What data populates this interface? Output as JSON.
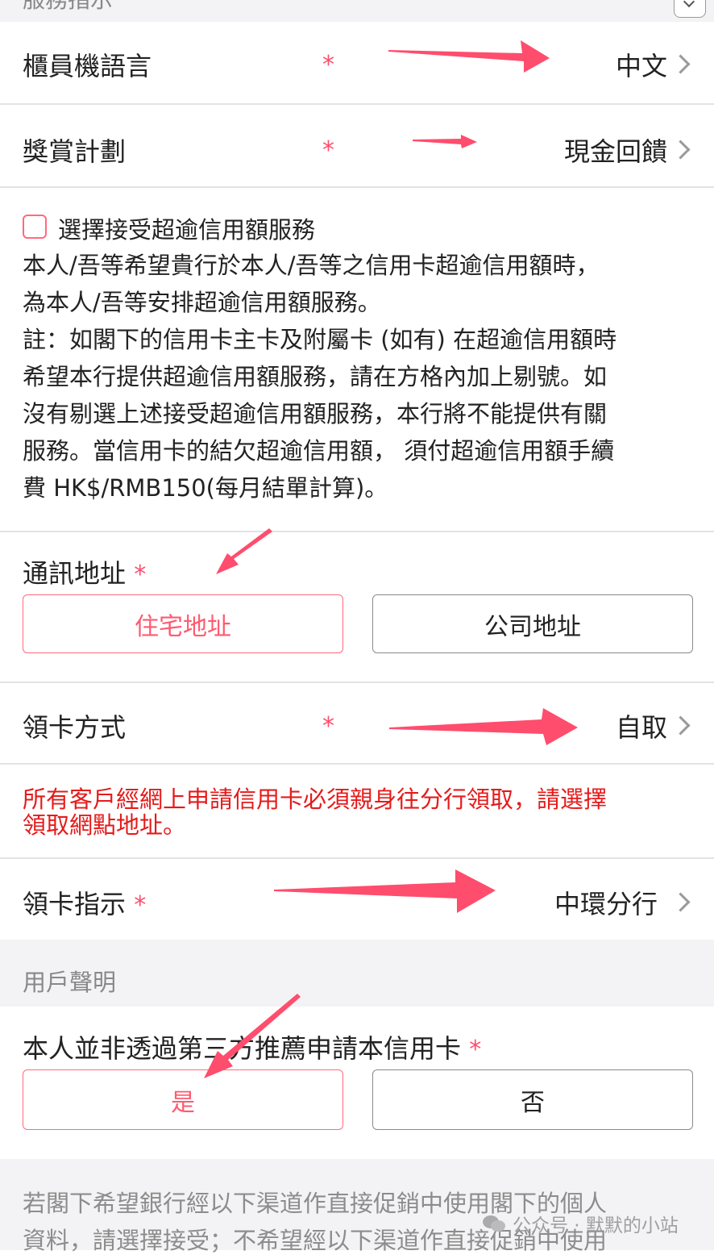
{
  "top_section": {
    "partial_title": "服務指示"
  },
  "kiosk_language": {
    "label": "櫃員機語言",
    "required": "*",
    "value": "中文"
  },
  "reward_plan": {
    "label": "獎賞計劃",
    "required": "*",
    "value": "現金回饋"
  },
  "over_limit": {
    "checkbox_label": "選擇接受超逾信用額服務",
    "lines": [
      "本人/吾等希望貴行於本人/吾等之信用卡超逾信用額時，",
      "為本人/吾等安排超逾信用額服務。",
      "註：如閣下的信用卡主卡及附屬卡 (如有) 在超逾信用額時",
      "希望本行提供超逾信用額服務，請在方格內加上剔號。如",
      "沒有剔選上述接受超逾信用額服務，本行將不能提供有關",
      "服務。當信用卡的結欠超逾信用額，  須付超逾信用額手續",
      "費 HK$/RMB150(每月結單計算)。"
    ]
  },
  "address": {
    "label": "通訊地址",
    "required": "*",
    "options": [
      "住宅地址",
      "公司地址"
    ],
    "selected": "住宅地址"
  },
  "card_collection": {
    "label": "領卡方式",
    "required": "*",
    "value": "自取"
  },
  "notice": {
    "lines": [
      "所有客戶經網上申請信用卡必須親身往分行領取，請選擇",
      "領取網點地址。"
    ],
    "color": "#e51b1b"
  },
  "card_instruction": {
    "label": "領卡指示",
    "required": "*",
    "value": "中環分行"
  },
  "user_declaration": {
    "section_title": "用戶聲明"
  },
  "referral": {
    "question": "本人並非透過第三方推薦申請本信用卡",
    "required": "*",
    "options": [
      "是",
      "否"
    ],
    "selected": "是"
  },
  "marketing": {
    "lines": [
      "若閣下希望銀行經以下渠道作直接促銷中使用閣下的個人",
      "資料，請選擇接受；不希望經以下渠道作直接促銷中使用"
    ]
  },
  "watermark": {
    "text": "公众号 · 默默的小站"
  },
  "colors": {
    "accent": "#ff5a70",
    "annotation_arrow": "#ff4d6d",
    "section_bg": "#f3f3f5"
  }
}
